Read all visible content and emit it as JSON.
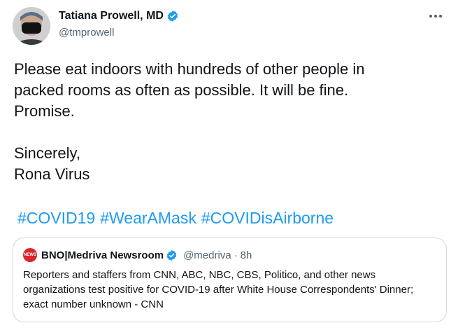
{
  "author": {
    "display_name": "Tatiana Prowell, MD",
    "handle": "@tmprowell",
    "verified": true,
    "avatar_icon": "profile-photo-masked"
  },
  "tweet": {
    "text": "Please eat indoors with hundreds of other people in\npacked rooms as often as possible. It will be fine.\nPromise.\n\nSincerely,\nRona Virus",
    "hashtags": [
      "#COVID19",
      "#WearAMask",
      "#COVIDisAirborne"
    ]
  },
  "quoted_tweet": {
    "display_name": "BNO|Medriva Newsroom",
    "handle": "@medriva",
    "separator": "·",
    "time": "8h",
    "verified": true,
    "avatar_text": "NEWS",
    "text": "Reporters and staffers from CNN, ABC, NBC, CBS, Politico, and other news organizations test positive for COVID-19 after White House Correspondents' Dinner; exact number unknown - CNN"
  },
  "colors": {
    "accent": "#1d9bf0",
    "text": "#0f1419",
    "muted": "#536471",
    "border": "#cfd9de",
    "news_red": "#d9252b"
  }
}
